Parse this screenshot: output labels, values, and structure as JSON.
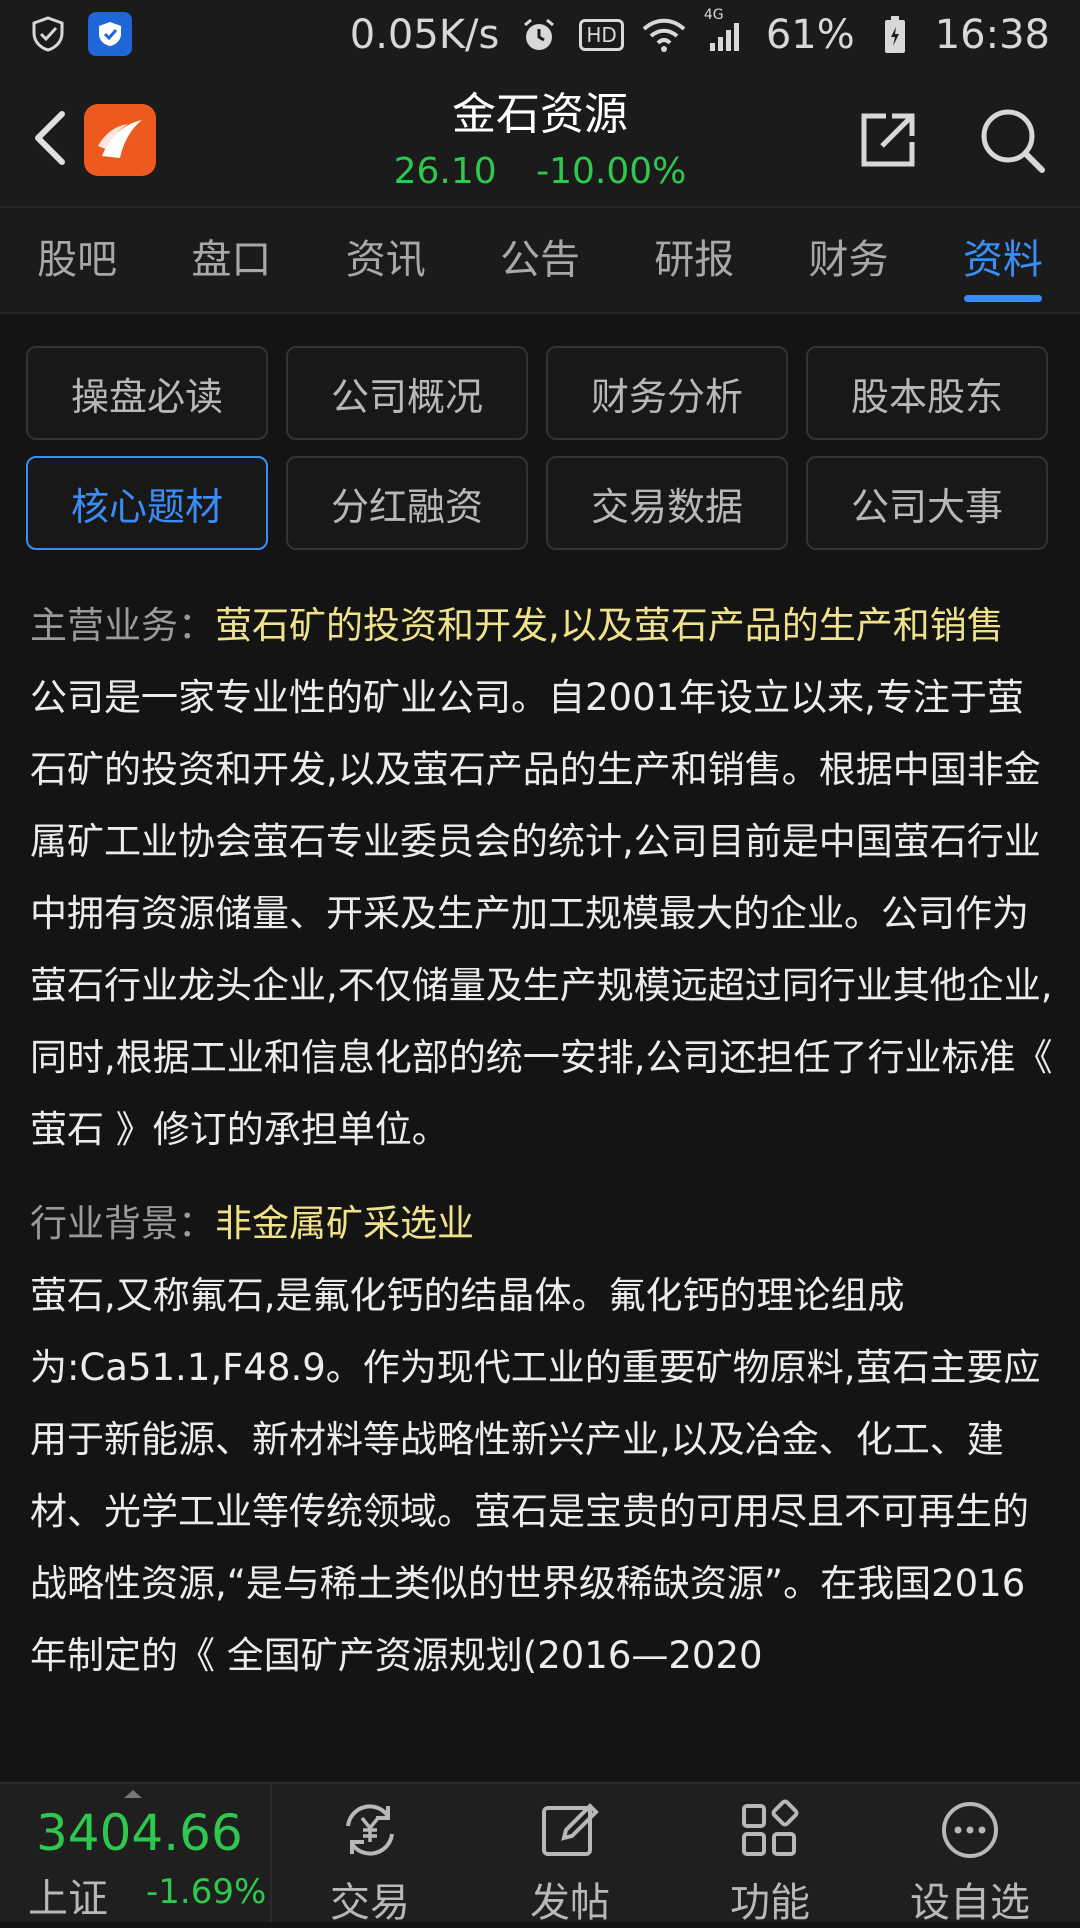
{
  "status_bar": {
    "network_speed": "0.05K/s",
    "hd": "HD",
    "signal_label": "4G",
    "battery": "61%",
    "time": "16:38"
  },
  "header": {
    "stock_name": "金石资源",
    "price": "26.10",
    "change_pct": "-10.00%"
  },
  "tabs": [
    {
      "label": "股吧"
    },
    {
      "label": "盘口"
    },
    {
      "label": "资讯"
    },
    {
      "label": "公告"
    },
    {
      "label": "研报"
    },
    {
      "label": "财务"
    },
    {
      "label": "资料",
      "active": true
    }
  ],
  "subnav": [
    {
      "label": "操盘必读"
    },
    {
      "label": "公司概况"
    },
    {
      "label": "财务分析"
    },
    {
      "label": "股本股东"
    },
    {
      "label": "核心题材",
      "active": true
    },
    {
      "label": "分红融资"
    },
    {
      "label": "交易数据"
    },
    {
      "label": "公司大事"
    }
  ],
  "content": {
    "main_business_label": "主营业务：",
    "main_business_value": "萤石矿的投资和开发,以及萤石产品的生产和销售",
    "main_business_text": "公司是一家专业性的矿业公司。自2001年设立以来,专注于萤石矿的投资和开发,以及萤石产品的生产和销售。根据中国非金属矿工业协会萤石专业委员会的统计,公司目前是中国萤石行业中拥有资源储量、开采及生产加工规模最大的企业。公司作为萤石行业龙头企业,不仅储量及生产规模远超过同行业其他企业,同时,根据工业和信息化部的统一安排,公司还担任了行业标准《 萤石 》修订的承担单位。",
    "industry_label": "行业背景：",
    "industry_value": "非金属矿采选业",
    "industry_text": "萤石,又称氟石,是氟化钙的结晶体。氟化钙的理论组成为:Ca51.1,F48.9。作为现代工业的重要矿物原料,萤石主要应用于新能源、新材料等战略性新兴产业,以及冶金、化工、建材、光学工业等传统领域。萤石是宝贵的可用尽且不可再生的战略性资源,“是与稀土类似的世界级稀缺资源”。在我国2016年制定的《 全国矿产资源规划(2016—2020"
  },
  "bottom_bar": {
    "index_value": "3404.66",
    "index_name": "上证",
    "index_change": "-1.69%",
    "nav": [
      {
        "label": "交易",
        "icon": "yuan-exchange-icon"
      },
      {
        "label": "发帖",
        "icon": "edit-post-icon"
      },
      {
        "label": "功能",
        "icon": "grid-function-icon"
      },
      {
        "label": "设自选",
        "icon": "more-dots-icon"
      }
    ]
  },
  "colors": {
    "accent": "#3a8df5",
    "down": "#2ec84e",
    "highlight": "#f0e28a",
    "background": "#141414"
  }
}
